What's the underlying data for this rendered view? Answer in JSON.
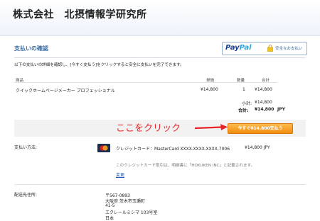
{
  "header": {
    "company": "株式会社　北摂情報学研究所"
  },
  "page_title": "支払いの確認",
  "paypal": {
    "logo_part1": "Pay",
    "logo_part2": "Pal",
    "secure_label": "安全なお支払い"
  },
  "instructions": "以下の支払いの詳細を確認し、[今すぐ支払う]をクリックすると安全に支払いを完了できます。",
  "table": {
    "headers": {
      "item": "商品",
      "price": "単価",
      "qty": "数量",
      "total": "合計"
    },
    "rows": [
      {
        "item": "クイックホームページメーカー プロフェッショナル",
        "price": "¥14,800",
        "qty": "1",
        "total": "¥14,800"
      }
    ],
    "subtotal_label": "小計:",
    "subtotal": "¥14,800",
    "total_label": "合計:",
    "total": "¥14,800",
    "currency": "JPY"
  },
  "annotation": "ここをクリック",
  "pay_button": "今すぐ¥14,800支払う",
  "payment": {
    "label": "支払い方法:",
    "card_icon": "mastercard-icon",
    "card": "クレジットカード：MasterCard XXXX-XXXX-XXXX-7006",
    "amount": "¥14,800 JPY",
    "note": "このクレジットカード取引は、明細書に「HOKUKEN INC」と記載されます。",
    "change": "変更"
  },
  "shipping": {
    "label": "配送先住所:",
    "lines": [
      "〒567-0893",
      "大阪府 茨木市玉瀬町",
      "41-5",
      "エクレールミシマ 103号室",
      "日本"
    ]
  },
  "colors": {
    "accent": "#3b6ea5",
    "button": "#f28c10",
    "annotation": "#e8242a"
  }
}
